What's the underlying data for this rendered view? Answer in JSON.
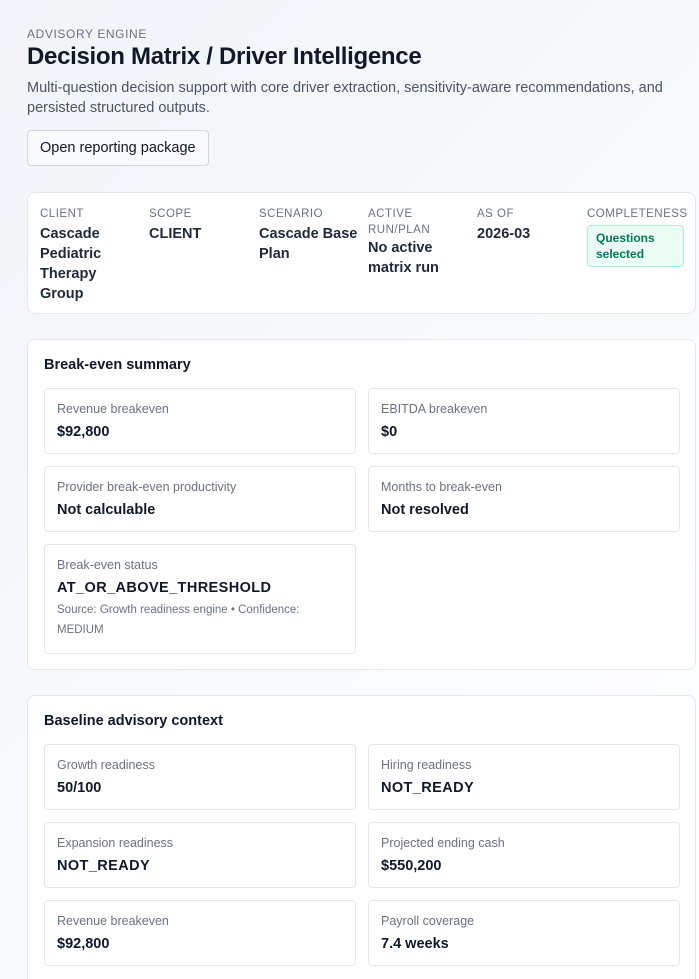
{
  "header": {
    "eyebrow": "ADVISORY ENGINE",
    "title": "Decision Matrix / Driver Intelligence",
    "subtitle": "Multi-question decision support with core driver extraction, sensitivity-aware recommendations, and persisted structured outputs.",
    "open_button": "Open reporting package"
  },
  "context": {
    "client_label": "CLIENT",
    "client_value": "Cascade Pediatric Therapy Group",
    "scope_label": "SCOPE",
    "scope_value": "CLIENT",
    "scenario_label": "SCENARIO",
    "scenario_value": "Cascade Base Plan",
    "run_label": "ACTIVE RUN/PLAN",
    "run_value": "No active matrix run",
    "asof_label": "AS OF",
    "asof_value": "2026-03",
    "completeness_label": "COMPLETENESS",
    "completeness_value": "Questions selected",
    "completeness_color": "#047857"
  },
  "breakeven": {
    "title": "Break-even summary",
    "revenue_label": "Revenue breakeven",
    "revenue_value": "$92,800",
    "ebitda_label": "EBITDA breakeven",
    "ebitda_value": "$0",
    "provider_label": "Provider break-even productivity",
    "provider_value": "Not calculable",
    "months_label": "Months to break-even",
    "months_value": "Not resolved",
    "status_label": "Break-even status",
    "status_value": "AT_OR_ABOVE_THRESHOLD",
    "status_note": "Source: Growth readiness engine • Confidence: MEDIUM"
  },
  "baseline": {
    "title": "Baseline advisory context",
    "growth_label": "Growth readiness",
    "growth_value": "50/100",
    "hiring_label": "Hiring readiness",
    "hiring_value": "NOT_READY",
    "expansion_label": "Expansion readiness",
    "expansion_value": "NOT_READY",
    "cash_label": "Projected ending cash",
    "cash_value": "$550,200",
    "revenue_label": "Revenue breakeven",
    "revenue_value": "$92,800",
    "payroll_label": "Payroll coverage",
    "payroll_value": "7.4 weeks"
  }
}
